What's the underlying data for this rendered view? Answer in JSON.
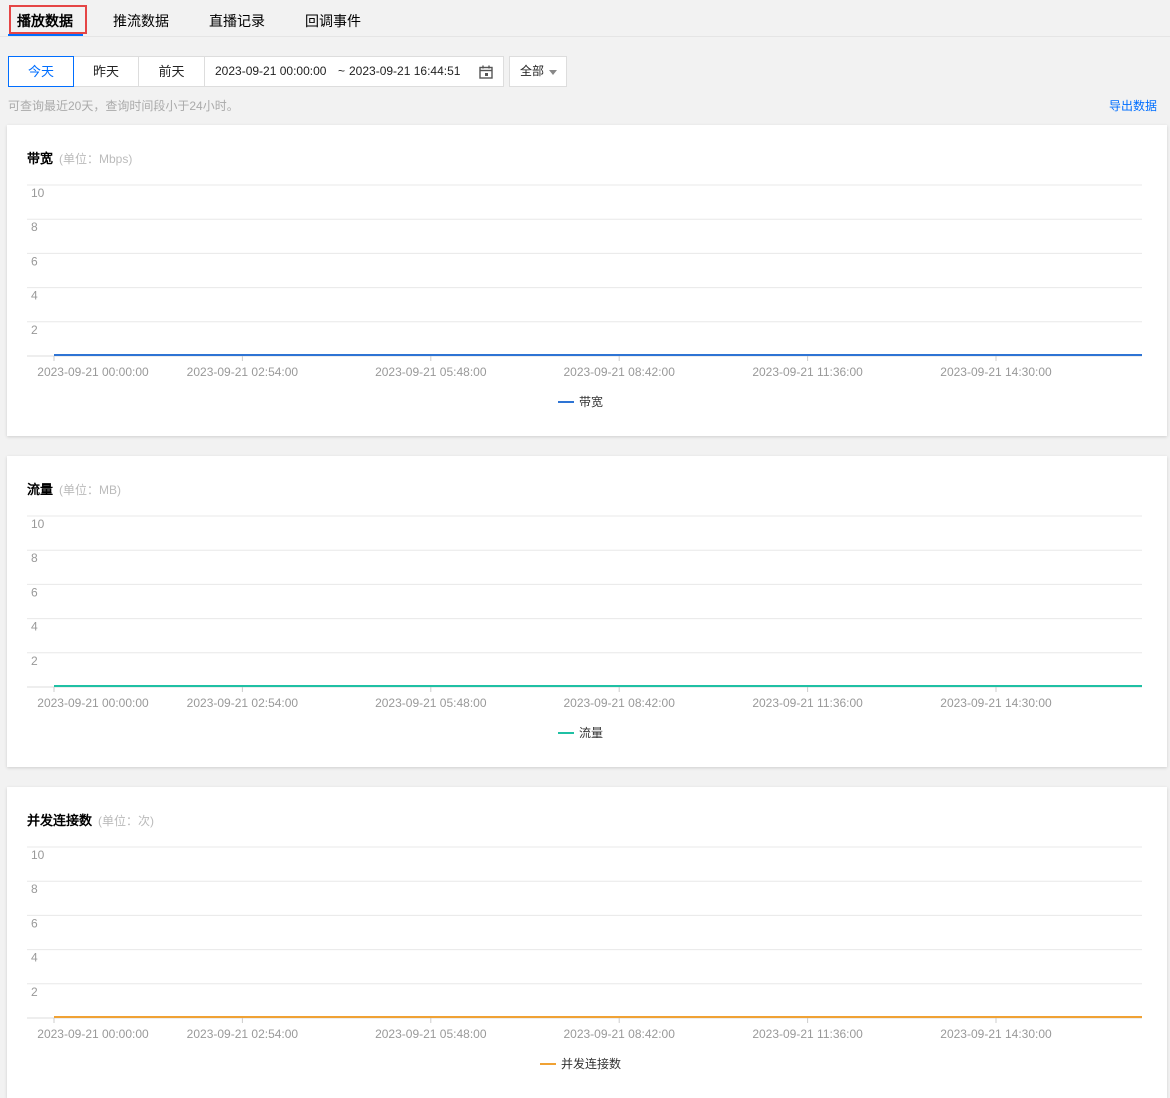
{
  "tabs": [
    {
      "label": "播放数据",
      "active": true
    },
    {
      "label": "推流数据",
      "active": false
    },
    {
      "label": "直播记录",
      "active": false
    },
    {
      "label": "回调事件",
      "active": false
    }
  ],
  "toolbar": {
    "quick_ranges": [
      "今天",
      "昨天",
      "前天"
    ],
    "active_range": "今天",
    "range_start": "2023-09-21 00:00:00",
    "range_sep": "~",
    "range_end": "2023-09-21 16:44:51",
    "calendar_icon": "calendar-icon",
    "filter_value": "全部",
    "filter_icon": "chevron-down-icon"
  },
  "hint": "可查询最近20天，查询时间段小于24小时。",
  "export_label": "导出数据",
  "colors": {
    "accent": "#006eff",
    "bandwidth": "#2e74d4",
    "traffic": "#1fc0a4",
    "connections": "#f0a234",
    "highlight_border": "#e54545"
  },
  "chart_data": [
    {
      "type": "line",
      "title": "带宽",
      "unit": "(单位：Mbps)",
      "yticks": [
        "10",
        "8",
        "6",
        "4",
        "2"
      ],
      "ylim": [
        0,
        10
      ],
      "xticks": [
        "2023-09-21 00:00:00",
        "2023-09-21 02:54:00",
        "2023-09-21 05:48:00",
        "2023-09-21 08:42:00",
        "2023-09-21 11:36:00",
        "2023-09-21 14:30:00"
      ],
      "grid": true,
      "legend": "bottom-center",
      "series": [
        {
          "name": "带宽",
          "color": "#2e74d4",
          "values": [
            0,
            0,
            0,
            0,
            0,
            0,
            0
          ]
        }
      ]
    },
    {
      "type": "line",
      "title": "流量",
      "unit": "(单位：MB)",
      "yticks": [
        "10",
        "8",
        "6",
        "4",
        "2"
      ],
      "ylim": [
        0,
        10
      ],
      "xticks": [
        "2023-09-21 00:00:00",
        "2023-09-21 02:54:00",
        "2023-09-21 05:48:00",
        "2023-09-21 08:42:00",
        "2023-09-21 11:36:00",
        "2023-09-21 14:30:00"
      ],
      "grid": true,
      "legend": "bottom-center",
      "series": [
        {
          "name": "流量",
          "color": "#1fc0a4",
          "values": [
            0,
            0,
            0,
            0,
            0,
            0,
            0
          ]
        }
      ]
    },
    {
      "type": "line",
      "title": "并发连接数",
      "unit": "(单位：次)",
      "yticks": [
        "10",
        "8",
        "6",
        "4",
        "2"
      ],
      "ylim": [
        0,
        10
      ],
      "xticks": [
        "2023-09-21 00:00:00",
        "2023-09-21 02:54:00",
        "2023-09-21 05:48:00",
        "2023-09-21 08:42:00",
        "2023-09-21 11:36:00",
        "2023-09-21 14:30:00"
      ],
      "grid": true,
      "legend": "bottom-center",
      "series": [
        {
          "name": "并发连接数",
          "color": "#f0a234",
          "values": [
            0,
            0,
            0,
            0,
            0,
            0,
            0
          ]
        }
      ]
    }
  ]
}
